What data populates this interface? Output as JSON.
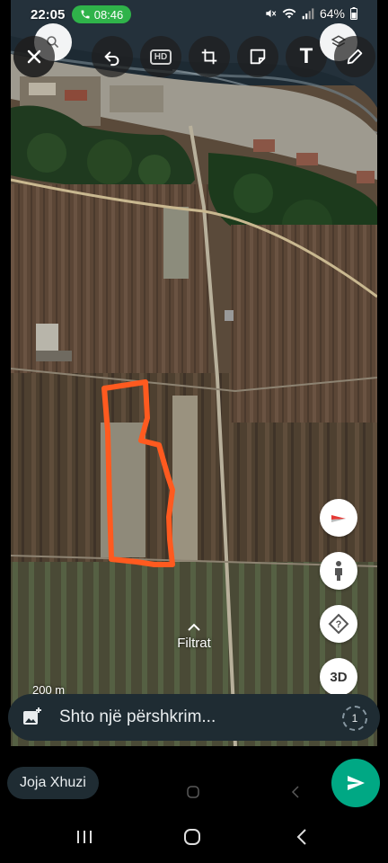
{
  "status_bar": {
    "time": "22:05",
    "call_duration": "08:46",
    "battery": "64%"
  },
  "editor_toolbar": {
    "hd_label": "HD",
    "text_label": "T"
  },
  "map": {
    "filter_label": "Filtrat",
    "scale_label": "200 m",
    "view_3d_label": "3D",
    "outline_color": "#ff5a1f"
  },
  "composer": {
    "caption_placeholder": "Shto një përshkrim...",
    "view_once_label": "1",
    "recipient": "Joja Xhuzi",
    "accent_color": "#00a884"
  }
}
